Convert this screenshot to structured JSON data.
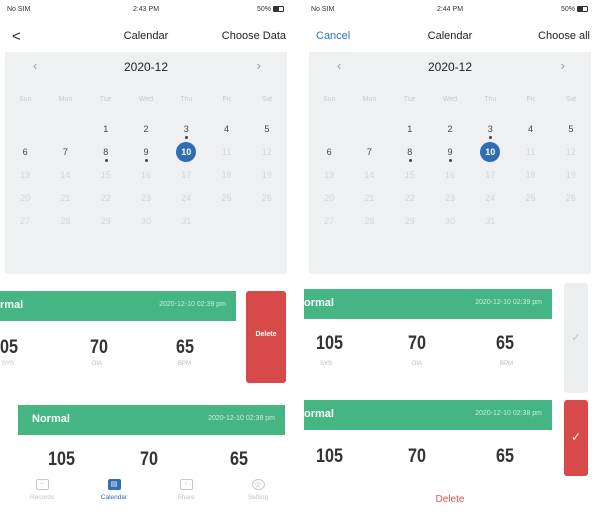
{
  "screen1": {
    "status": {
      "carrier": "No SIM",
      "time": "2:43 PM",
      "battery": "50%"
    },
    "nav": {
      "back": "<",
      "title": "Calendar",
      "right": "Choose Data"
    },
    "calendar": {
      "month": "2020-12",
      "prev": "‹",
      "next": "›",
      "weekdays": [
        "Sun",
        "Mon",
        "Tue",
        "Wed",
        "Thu",
        "Fri",
        "Sat"
      ],
      "days": [
        {
          "d": "",
          "f": false
        },
        {
          "d": "",
          "f": false
        },
        {
          "d": "1",
          "f": false
        },
        {
          "d": "2",
          "f": false
        },
        {
          "d": "3",
          "f": false,
          "dot": true
        },
        {
          "d": "4",
          "f": false
        },
        {
          "d": "5",
          "f": false
        },
        {
          "d": "6",
          "f": false
        },
        {
          "d": "7",
          "f": false
        },
        {
          "d": "8",
          "f": false,
          "dot": true
        },
        {
          "d": "9",
          "f": false,
          "dot": true
        },
        {
          "d": "10",
          "f": false,
          "sel": true
        },
        {
          "d": "11",
          "f": true
        },
        {
          "d": "12",
          "f": true
        },
        {
          "d": "13",
          "f": true
        },
        {
          "d": "14",
          "f": true
        },
        {
          "d": "15",
          "f": true
        },
        {
          "d": "16",
          "f": true
        },
        {
          "d": "17",
          "f": true
        },
        {
          "d": "18",
          "f": true
        },
        {
          "d": "19",
          "f": true
        },
        {
          "d": "20",
          "f": true
        },
        {
          "d": "21",
          "f": true
        },
        {
          "d": "22",
          "f": true
        },
        {
          "d": "23",
          "f": true
        },
        {
          "d": "24",
          "f": true
        },
        {
          "d": "25",
          "f": true
        },
        {
          "d": "26",
          "f": true
        },
        {
          "d": "27",
          "f": true
        },
        {
          "d": "28",
          "f": true
        },
        {
          "d": "29",
          "f": true
        },
        {
          "d": "30",
          "f": true
        },
        {
          "d": "31",
          "f": true
        }
      ]
    },
    "cards": [
      {
        "status": "rmal",
        "time": "2020-12-10 02:39 pm",
        "sys": "05",
        "dia": "70",
        "bpm": "65",
        "sys_label": "SYS",
        "dia_label": "DIA",
        "bpm_label": "BPM",
        "action": "Delete"
      },
      {
        "status": "Normal",
        "time": "2020-12-10 02:38 pm",
        "sys": "105",
        "dia": "70",
        "bpm": "65"
      }
    ],
    "tabs": [
      {
        "label": "Records",
        "icon": "records-icon",
        "glyph": "~"
      },
      {
        "label": "Calendar",
        "icon": "calendar-icon",
        "glyph": "▤",
        "active": true
      },
      {
        "label": "Share",
        "icon": "share-icon",
        "glyph": "↑"
      },
      {
        "label": "Setting",
        "icon": "setting-icon",
        "glyph": "◎"
      }
    ]
  },
  "screen2": {
    "status": {
      "carrier": "No SIM",
      "time": "2:44 PM",
      "battery": "50%"
    },
    "nav": {
      "left": "Cancel",
      "title": "Calendar",
      "right": "Choose all"
    },
    "cards": [
      {
        "status": "ormal",
        "time": "2020-12-10 02:39 pm",
        "sys": "105",
        "dia": "70",
        "bpm": "65",
        "sys_label": "SYS",
        "dia_label": "DIA",
        "bpm_label": "BPM",
        "checked": false
      },
      {
        "status": "ormal",
        "time": "2020-12-10 02:38 pm",
        "sys": "105",
        "dia": "70",
        "bpm": "65",
        "checked": true
      }
    ],
    "delete_label": "Delete"
  },
  "colors": {
    "accent": "#2f6db5",
    "normal_green": "#45b683",
    "delete_red": "#d84a4a"
  }
}
